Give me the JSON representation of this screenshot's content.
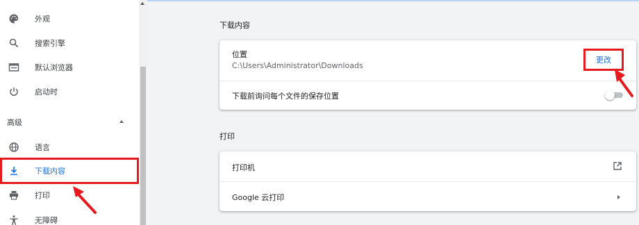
{
  "sidebar": {
    "items": [
      {
        "label": "外观",
        "icon": "palette-icon"
      },
      {
        "label": "搜索引擎",
        "icon": "search-icon"
      },
      {
        "label": "默认浏览器",
        "icon": "browser-icon"
      },
      {
        "label": "启动时",
        "icon": "power-icon"
      }
    ],
    "advanced_label": "高级",
    "advanced_items": [
      {
        "label": "语言",
        "icon": "globe-icon"
      },
      {
        "label": "下载内容",
        "icon": "download-icon",
        "active": true
      },
      {
        "label": "打印",
        "icon": "print-icon"
      },
      {
        "label": "无障碍",
        "icon": "accessibility-icon"
      }
    ]
  },
  "downloads": {
    "heading": "下载内容",
    "location_label": "位置",
    "location_path": "C:\\Users\\Administrator\\Downloads",
    "change_button": "更改",
    "ask_label": "下载前询问每个文件的保存位置",
    "ask_enabled": false
  },
  "printing": {
    "heading": "打印",
    "printers_label": "打印机",
    "cloud_print_label": "Google 云打印"
  },
  "colors": {
    "accent": "#1a73e8",
    "highlight": "#e8191c"
  }
}
